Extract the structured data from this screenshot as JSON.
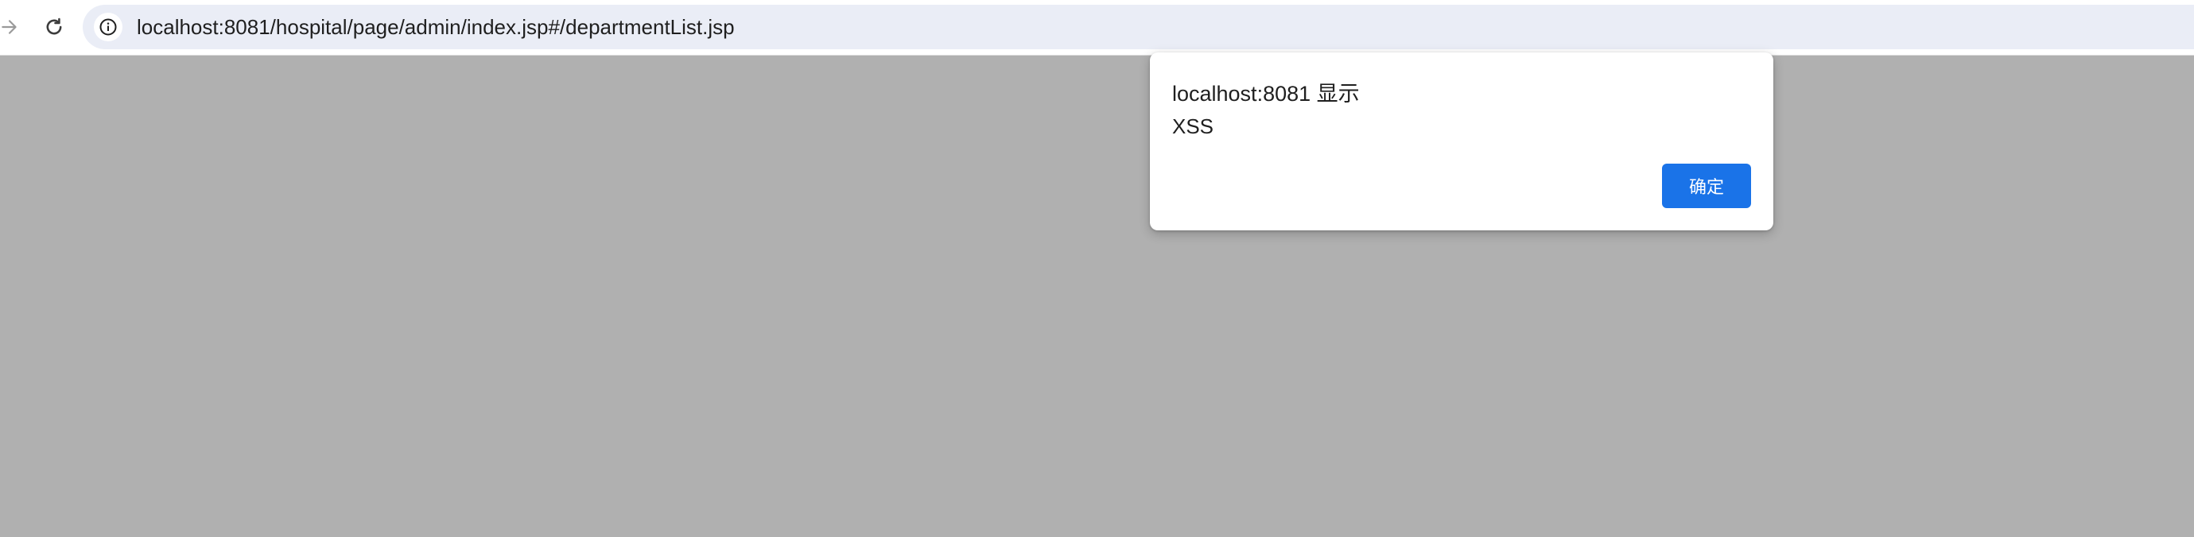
{
  "browser": {
    "address_bar": {
      "url": "localhost:8081/hospital/page/admin/index.jsp#/departmentList.jsp",
      "site_info_icon": "info-circle-icon"
    },
    "nav": {
      "forward_icon": "arrow-right-icon",
      "reload_icon": "reload-icon"
    }
  },
  "alert_dialog": {
    "title": "localhost:8081 显示",
    "message": "XSS",
    "ok_label": "确定"
  },
  "colors": {
    "overlay_background": "#b0b0b0",
    "omnibox_background": "#eaedf6",
    "ok_button": "#1a73e8"
  }
}
